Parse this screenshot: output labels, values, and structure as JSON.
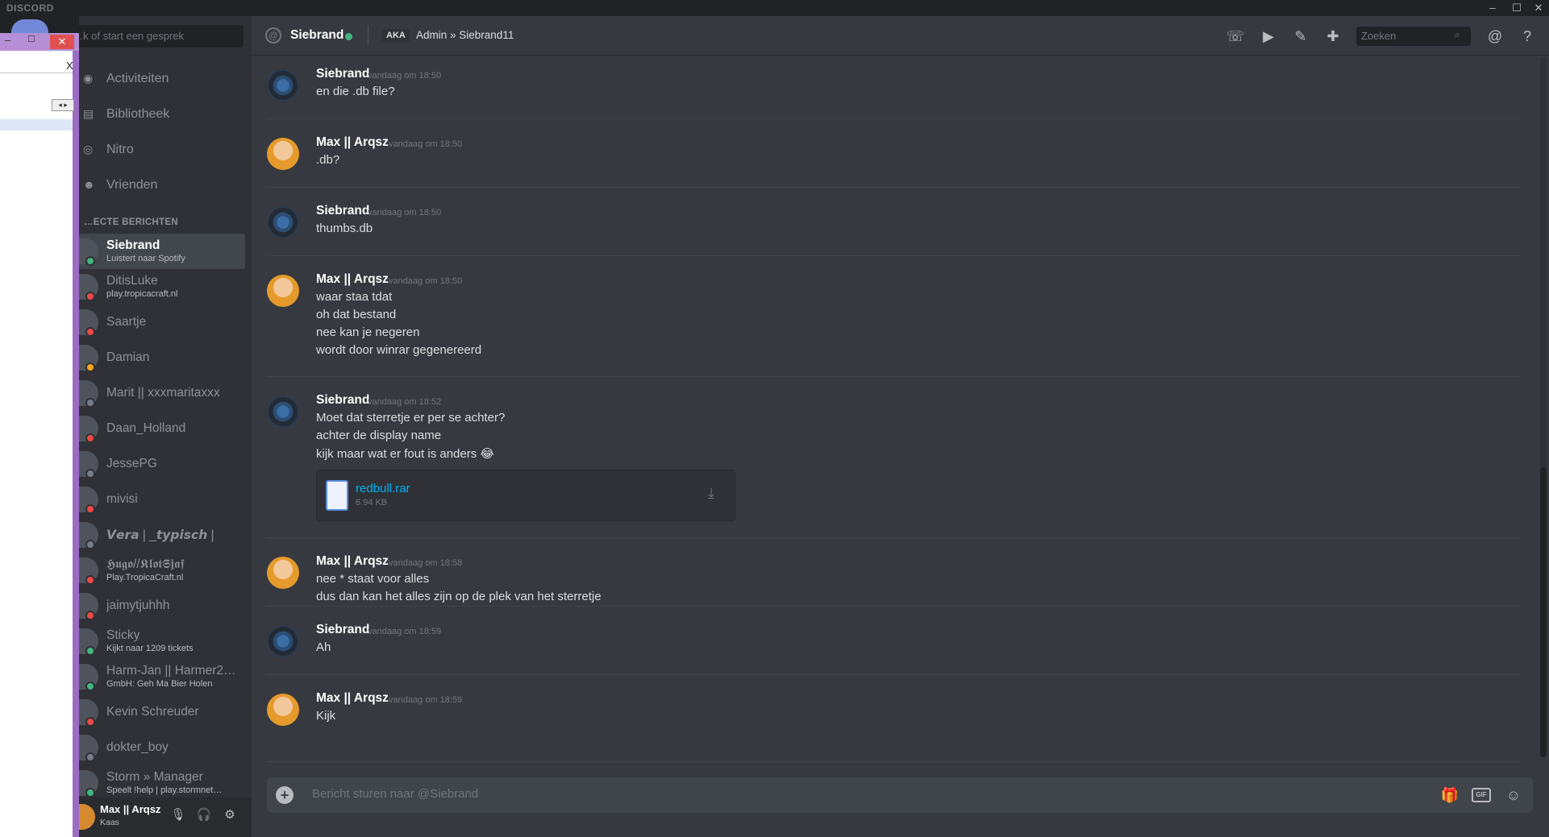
{
  "app": {
    "brand": "DISCORD"
  },
  "window_controls": [
    "–",
    "☐",
    "✕"
  ],
  "overlay": {
    "min": "–",
    "max": "☐",
    "close": "✕",
    "x_label": "X",
    "scroll_arrows": "◂ ▸"
  },
  "search": {
    "placeholder": "…k of start een gesprek"
  },
  "nav": [
    {
      "label": "Activiteiten",
      "icon": "activity-icon"
    },
    {
      "label": "Bibliotheek",
      "icon": "library-icon"
    },
    {
      "label": "Nitro",
      "icon": "nitro-icon"
    },
    {
      "label": "Vrienden",
      "icon": "friends-icon"
    }
  ],
  "dm_header": "…ECTE BERICHTEN",
  "dms": [
    {
      "name": "Siebrand",
      "sub": "Luistert naar Spotify",
      "status": "online",
      "active": true
    },
    {
      "name": "DitisLuke",
      "sub": "play.tropicacraft.nl",
      "status": "dnd"
    },
    {
      "name": "Saartje",
      "sub": "",
      "status": "dnd"
    },
    {
      "name": "Damian",
      "sub": "",
      "status": "idle"
    },
    {
      "name": "Marit || xxxmaritaxxx",
      "sub": "",
      "status": "offline"
    },
    {
      "name": "Daan_Holland",
      "sub": "",
      "status": "dnd"
    },
    {
      "name": "JessePG",
      "sub": "",
      "status": "offline"
    },
    {
      "name": "mivisi",
      "sub": "",
      "status": "dnd"
    },
    {
      "name": "𝙑𝙚𝙧𝙖 | _𝙩𝙮𝙥𝙞𝙨𝙘𝙝 |",
      "sub": "",
      "status": "offline"
    },
    {
      "name": "𝕳𝖚𝖌𝖔//𝕶𝖑𝖔𝖙𝕾𝖏𝖆𝖋",
      "sub": "Play.TropicaCraft.nl",
      "status": "dnd"
    },
    {
      "name": "jaimytjuhhh",
      "sub": "",
      "status": "dnd"
    },
    {
      "name": "Sticky",
      "sub": "Kijkt naar 1209 tickets",
      "status": "online"
    },
    {
      "name": "Harm-Jan || Harmer2…",
      "sub": "GmbH: Geh Ma Bier Holen",
      "status": "online"
    },
    {
      "name": "Kevin Schreuder",
      "sub": "",
      "status": "dnd"
    },
    {
      "name": "dokter_boy",
      "sub": "",
      "status": "offline"
    },
    {
      "name": "Storm » Manager",
      "sub": "Speelt !help | play.stormnet…",
      "status": "online"
    }
  ],
  "user_panel": {
    "name": "Max || Arqsz",
    "sub": "Kaas"
  },
  "header": {
    "at": "@",
    "name": "Siebrand",
    "aka": "AKA",
    "alias": "Admin » Siebrand11",
    "search_placeholder": "Zoeken"
  },
  "messages": [
    {
      "author": "Siebrand",
      "avatar": "siebrand",
      "time": "vandaag om 18:50",
      "lines": [
        "en die .db file?"
      ]
    },
    {
      "author": "Max || Arqsz",
      "avatar": "max",
      "time": "vandaag om 18:50",
      "lines": [
        ".db?"
      ]
    },
    {
      "author": "Siebrand",
      "avatar": "siebrand",
      "time": "vandaag om 18:50",
      "lines": [
        "thumbs.db"
      ]
    },
    {
      "author": "Max || Arqsz",
      "avatar": "max",
      "time": "vandaag om 18:50",
      "lines": [
        "waar staa tdat",
        "oh dat bestand",
        "nee kan je negeren",
        "wordt door winrar gegenereerd"
      ]
    },
    {
      "author": "Siebrand",
      "avatar": "siebrand",
      "time": "vandaag om 18:52",
      "lines": [
        "Moet dat sterretje er per se achter?",
        "achter de display name",
        "kijk maar wat er fout is anders 😂"
      ]
    },
    {
      "author": "Max || Arqsz",
      "avatar": "max",
      "time": "vandaag om 18:58",
      "lines": [
        "nee * staat voor alles",
        "dus dan kan het alles zijn op de plek van het sterretje"
      ]
    },
    {
      "author": "Siebrand",
      "avatar": "siebrand",
      "time": "vandaag om 18:59",
      "lines": [
        "Ah"
      ]
    },
    {
      "author": "Max || Arqsz",
      "avatar": "max",
      "time": "vandaag om 18:59",
      "lines": [
        "Kijk"
      ]
    }
  ],
  "attachment": {
    "name": "redbull.rar",
    "size": "6.94 KB"
  },
  "composer": {
    "placeholder": "Bericht sturen naar @Siebrand",
    "plus": "+",
    "gif": "GIF"
  }
}
